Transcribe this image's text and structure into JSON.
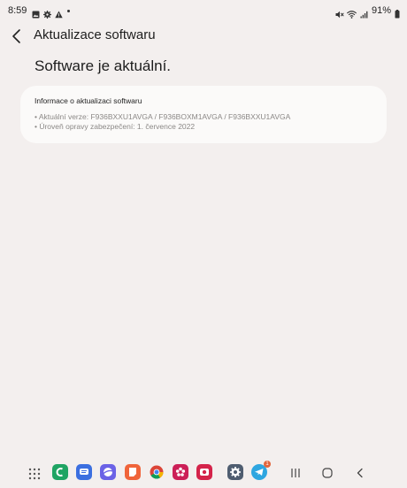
{
  "status_bar": {
    "time": "8:59",
    "battery": "91%",
    "left_icons": [
      "image-icon",
      "gear-icon",
      "warning-icon"
    ],
    "right_icons": [
      "mute-icon",
      "wifi-icon",
      "signal-icon",
      "battery-icon"
    ]
  },
  "app_bar": {
    "title": "Aktualizace softwaru"
  },
  "main": {
    "headline": "Software je aktuální."
  },
  "card": {
    "title": "Informace o aktualizaci softwaru",
    "lines": [
      "• Aktuální verze: F936BXXU1AVGA / F936BOXM1AVGA / F936BXXU1AVGA",
      "• Úroveň opravy zabezpečení: 1. července 2022"
    ]
  },
  "taskbar": {
    "apps": [
      {
        "name": "phone-app",
        "color": "#1fa463"
      },
      {
        "name": "messages-app",
        "color": "#3b6fe0"
      },
      {
        "name": "internet-app",
        "color": "#6b62e6"
      },
      {
        "name": "notes-app",
        "color": "#f0643a"
      },
      {
        "name": "chrome-app",
        "color": "#ffffff"
      },
      {
        "name": "bixby-app",
        "color": "#cc1f57"
      },
      {
        "name": "camera-app",
        "color": "#d4234a"
      },
      {
        "name": "settings-app",
        "color": "#4f5d70"
      },
      {
        "name": "telegram-app",
        "color": "#2ea6e0"
      }
    ],
    "telegram_badge": "1",
    "accent": "#e2653c"
  }
}
